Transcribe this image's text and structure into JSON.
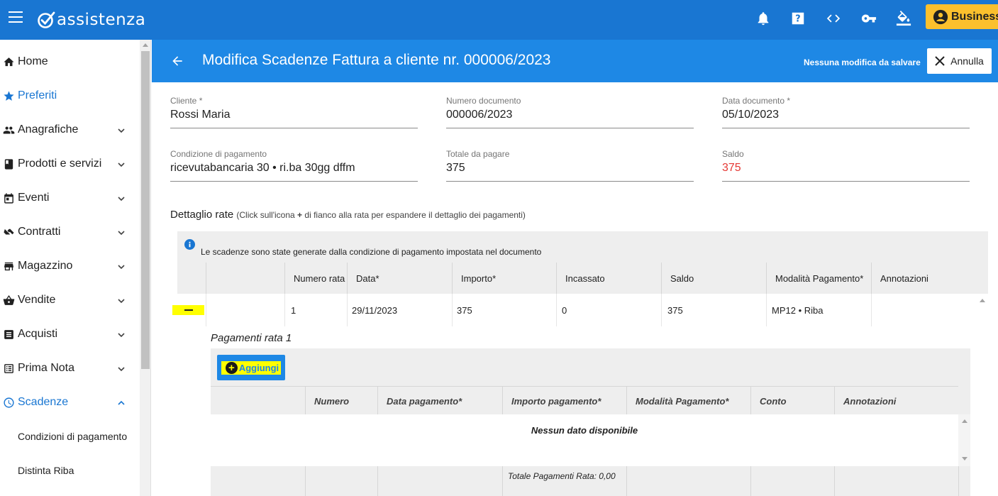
{
  "app": {
    "logo_text": "assistenza",
    "business_label": "Business"
  },
  "topbar_icons": [
    "bell-icon",
    "help-icon",
    "code-icon",
    "key-icon",
    "paint-bucket-icon"
  ],
  "sidebar": {
    "items": [
      {
        "label": "Home",
        "icon": "home-icon"
      },
      {
        "label": "Preferiti",
        "icon": "star-icon"
      },
      {
        "label": "Anagrafiche",
        "icon": "people-icon"
      },
      {
        "label": "Prodotti e servizi",
        "icon": "book-icon"
      },
      {
        "label": "Eventi",
        "icon": "calendar-icon"
      },
      {
        "label": "Contratti",
        "icon": "handshake-icon"
      },
      {
        "label": "Magazzino",
        "icon": "store-icon"
      },
      {
        "label": "Vendite",
        "icon": "basket-icon"
      },
      {
        "label": "Acquisti",
        "icon": "list-icon"
      },
      {
        "label": "Prima Nota",
        "icon": "ledger-icon"
      },
      {
        "label": "Scadenze",
        "icon": "clock-icon"
      }
    ],
    "subitems": [
      "Condizioni di pagamento",
      "Distinta Riba"
    ]
  },
  "header": {
    "title": "Modifica Scadenze Fattura a cliente nr. 000006/2023",
    "status": "Nessuna modifica da salvare",
    "cancel_label": "Annulla"
  },
  "form": {
    "cliente": {
      "label": "Cliente *",
      "value": "Rossi Maria"
    },
    "numero_documento": {
      "label": "Numero documento",
      "value": "000006/2023"
    },
    "data_documento": {
      "label": "Data documento *",
      "value": "05/10/2023"
    },
    "condizione_pagamento": {
      "label": "Condizione di pagamento",
      "value": "ricevutabancaria 30 • ri.ba 30gg dffm"
    },
    "totale_da_pagare": {
      "label": "Totale da pagare",
      "value": "375"
    },
    "saldo": {
      "label": "Saldo",
      "value": "375"
    }
  },
  "rate": {
    "title": "Dettaglio rate",
    "hint_pre": "(Click sull'icona ",
    "hint_plus": "+",
    "hint_post": " di fianco alla rata per espandere il dettaglio dei pagamenti)",
    "info": "Le scadenze sono state generate dalla condizione di pagamento impostata nel documento",
    "columns": [
      "Numero rata",
      "Data*",
      "Importo*",
      "Incassato",
      "Saldo",
      "Modalità Pagamento*",
      "Annotazioni"
    ],
    "row": {
      "numero": "1",
      "data": "29/11/2023",
      "importo": "375",
      "incassato": "0",
      "saldo": "375",
      "modalita": "MP12 • Riba",
      "annotazioni": ""
    }
  },
  "pagamenti": {
    "title": "Pagamenti rata 1",
    "add_label": "Aggiungi",
    "columns": [
      "Numero",
      "Data pagamento*",
      "Importo pagamento*",
      "Modalità Pagamento*",
      "Conto",
      "Annotazioni"
    ],
    "empty": "Nessun dato disponibile",
    "total": "Totale Pagamenti Rata: 0,00"
  }
}
